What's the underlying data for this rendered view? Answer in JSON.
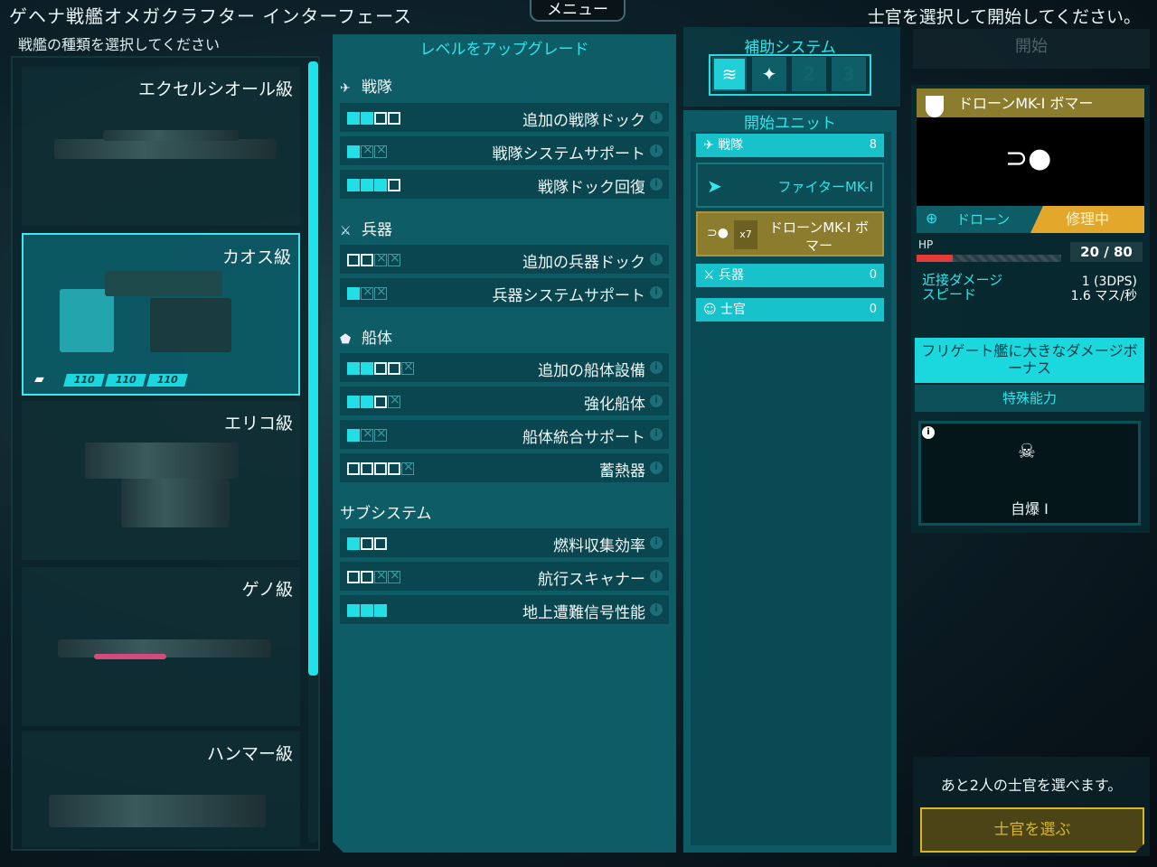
{
  "header": {
    "title": "ゲヘナ戦艦オメガクラフター インターフェース",
    "menu_label": "メニュー",
    "hint": "士官を選択して開始してください。"
  },
  "ships": {
    "header": "戦艦の種類を選択してください",
    "items": [
      {
        "name": "エクセルシオール級"
      },
      {
        "name": "カオス級",
        "stats": [
          "110",
          "110",
          "110"
        ]
      },
      {
        "name": "エリコ級"
      },
      {
        "name": "ゲノ級"
      },
      {
        "name": "ハンマー級"
      }
    ]
  },
  "upgrades": {
    "title": "レベルをアップグレード",
    "categories": [
      {
        "label": "戦隊",
        "icon": "✈",
        "rows": [
          {
            "name": "追加の戦隊ドック",
            "filled": 2,
            "empty": 2,
            "locked": 0
          },
          {
            "name": "戦隊システムサポート",
            "filled": 1,
            "empty": 0,
            "locked": 2
          },
          {
            "name": "戦隊ドック回復",
            "filled": 3,
            "empty": 1,
            "locked": 0
          }
        ]
      },
      {
        "label": "兵器",
        "icon": "⚔",
        "rows": [
          {
            "name": "追加の兵器ドック",
            "filled": 0,
            "empty": 2,
            "locked": 2
          },
          {
            "name": "兵器システムサポート",
            "filled": 1,
            "empty": 0,
            "locked": 2
          }
        ]
      },
      {
        "label": "船体",
        "icon": "⬟",
        "rows": [
          {
            "name": "追加の船体設備",
            "filled": 2,
            "empty": 2,
            "locked": 1
          },
          {
            "name": "強化船体",
            "filled": 2,
            "empty": 1,
            "locked": 1
          },
          {
            "name": "船体統合サポート",
            "filled": 1,
            "empty": 0,
            "locked": 2
          },
          {
            "name": "蓄熱器",
            "filled": 0,
            "empty": 4,
            "locked": 1
          }
        ]
      },
      {
        "label": "サブシステム",
        "icon": "",
        "rows": [
          {
            "name": "燃料収集効率",
            "filled": 1,
            "empty": 2,
            "locked": 0
          },
          {
            "name": "航行スキャナー",
            "filled": 0,
            "empty": 2,
            "locked": 2
          },
          {
            "name": "地上遭難信号性能",
            "filled": 3,
            "empty": 0,
            "locked": 0
          }
        ]
      }
    ],
    "info_glyph": "i"
  },
  "aux": {
    "title": "補助システム",
    "slots": [
      {
        "icon": "layers-icon",
        "glyph": "≋",
        "state": "on"
      },
      {
        "icon": "satellite-icon",
        "glyph": "✦",
        "state": "off"
      },
      {
        "icon": "slot-2",
        "glyph": "2",
        "state": "empty"
      },
      {
        "icon": "slot-3",
        "glyph": "3",
        "state": "empty"
      }
    ]
  },
  "units": {
    "title": "開始ユニット",
    "squadron": {
      "label": "戦隊",
      "count": "8"
    },
    "fighter": {
      "name": "ファイターMK-I"
    },
    "drone": {
      "name": "ドローンMK-I ボマー",
      "qty": "x7"
    },
    "weapons": {
      "label": "兵器",
      "count": "0"
    },
    "officers": {
      "label": "士官",
      "count": "0"
    }
  },
  "detail": {
    "start_label": "開始",
    "unit_name": "ドローンMK-I ボマー",
    "type_label": "ドローン",
    "status": "修理中",
    "hp_label": "HP",
    "hp_current": 20,
    "hp_max": 80,
    "hp_text": "20 / 80",
    "melee_label": "近接ダメージ",
    "melee_value": "1 (3DPS)",
    "speed_label": "スピード",
    "speed_value": "1.6 マス/秒",
    "bonus": "フリゲート艦に大きなダメージボーナス",
    "ability_title": "特殊能力",
    "ability_name": "自爆 I",
    "officer_text": "あと2人の士官を選べます。",
    "officer_button": "士官を選ぶ"
  },
  "colors": {
    "accent": "#1fe3e8",
    "panel": "#0e5c66",
    "gold": "#8c7c2e",
    "warning": "#e3a72c",
    "hp": "#e53a3a"
  }
}
